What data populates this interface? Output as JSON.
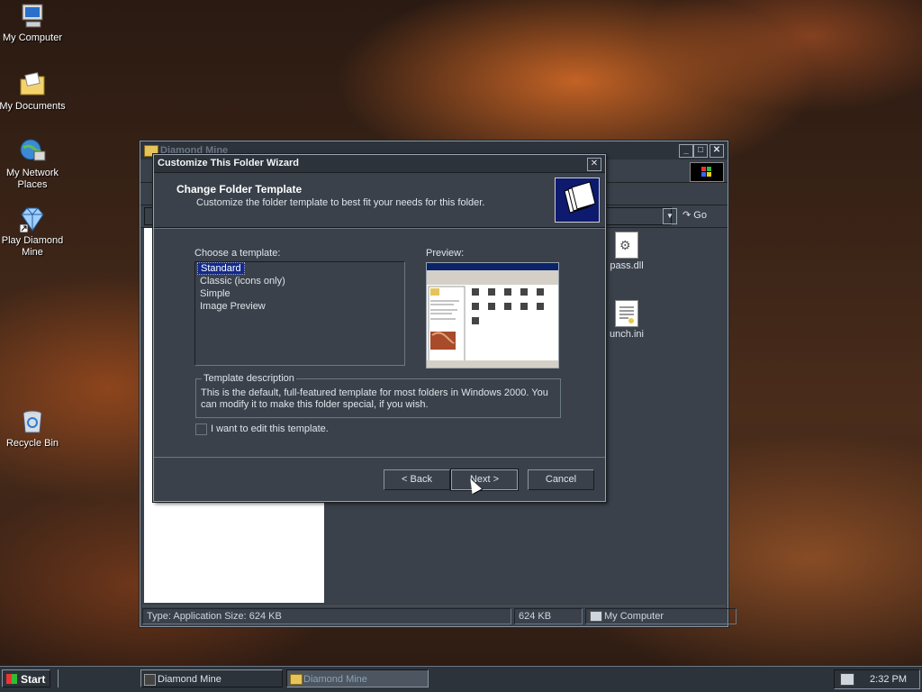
{
  "desktop": {
    "icons": [
      {
        "label": "My Computer",
        "icon": "computer-icon"
      },
      {
        "label": "My Documents",
        "icon": "folder-documents-icon"
      },
      {
        "label": "My Network Places",
        "icon": "network-places-icon"
      },
      {
        "label": "Play Diamond Mine",
        "icon": "diamond-icon"
      },
      {
        "label": "Recycle Bin",
        "icon": "recycle-bin-icon"
      }
    ]
  },
  "explorer": {
    "title": "Diamond Mine",
    "go_label": "Go",
    "files": [
      {
        "name": "pass.dll",
        "icon": "dll-gear-icon"
      },
      {
        "name": "unch.ini",
        "icon": "ini-file-icon"
      }
    ],
    "status": {
      "info": "Type: Application Size: 624 KB",
      "size": "624 KB",
      "zone": "My Computer"
    }
  },
  "wizard": {
    "title": "Customize This Folder Wizard",
    "heading": "Change Folder Template",
    "subheading": "Customize the folder template to best fit your needs for this folder.",
    "choose_label": "Choose a template:",
    "preview_label": "Preview:",
    "templates": [
      "Standard",
      "Classic (icons only)",
      "Simple",
      "Image Preview"
    ],
    "selected_template": "Standard",
    "description_legend": "Template description",
    "description": "This is the default, full-featured template for most folders in Windows 2000. You can modify it to make this folder special, if you wish.",
    "edit_checkbox_label": "I want to edit this template.",
    "edit_checked": false,
    "buttons": {
      "back": "< Back",
      "next": "Next >",
      "cancel": "Cancel"
    }
  },
  "taskbar": {
    "start_label": "Start",
    "tasks": [
      {
        "label": "Diamond Mine",
        "active": false
      },
      {
        "label": "Diamond Mine",
        "active": true
      }
    ],
    "clock": "2:32 PM"
  }
}
